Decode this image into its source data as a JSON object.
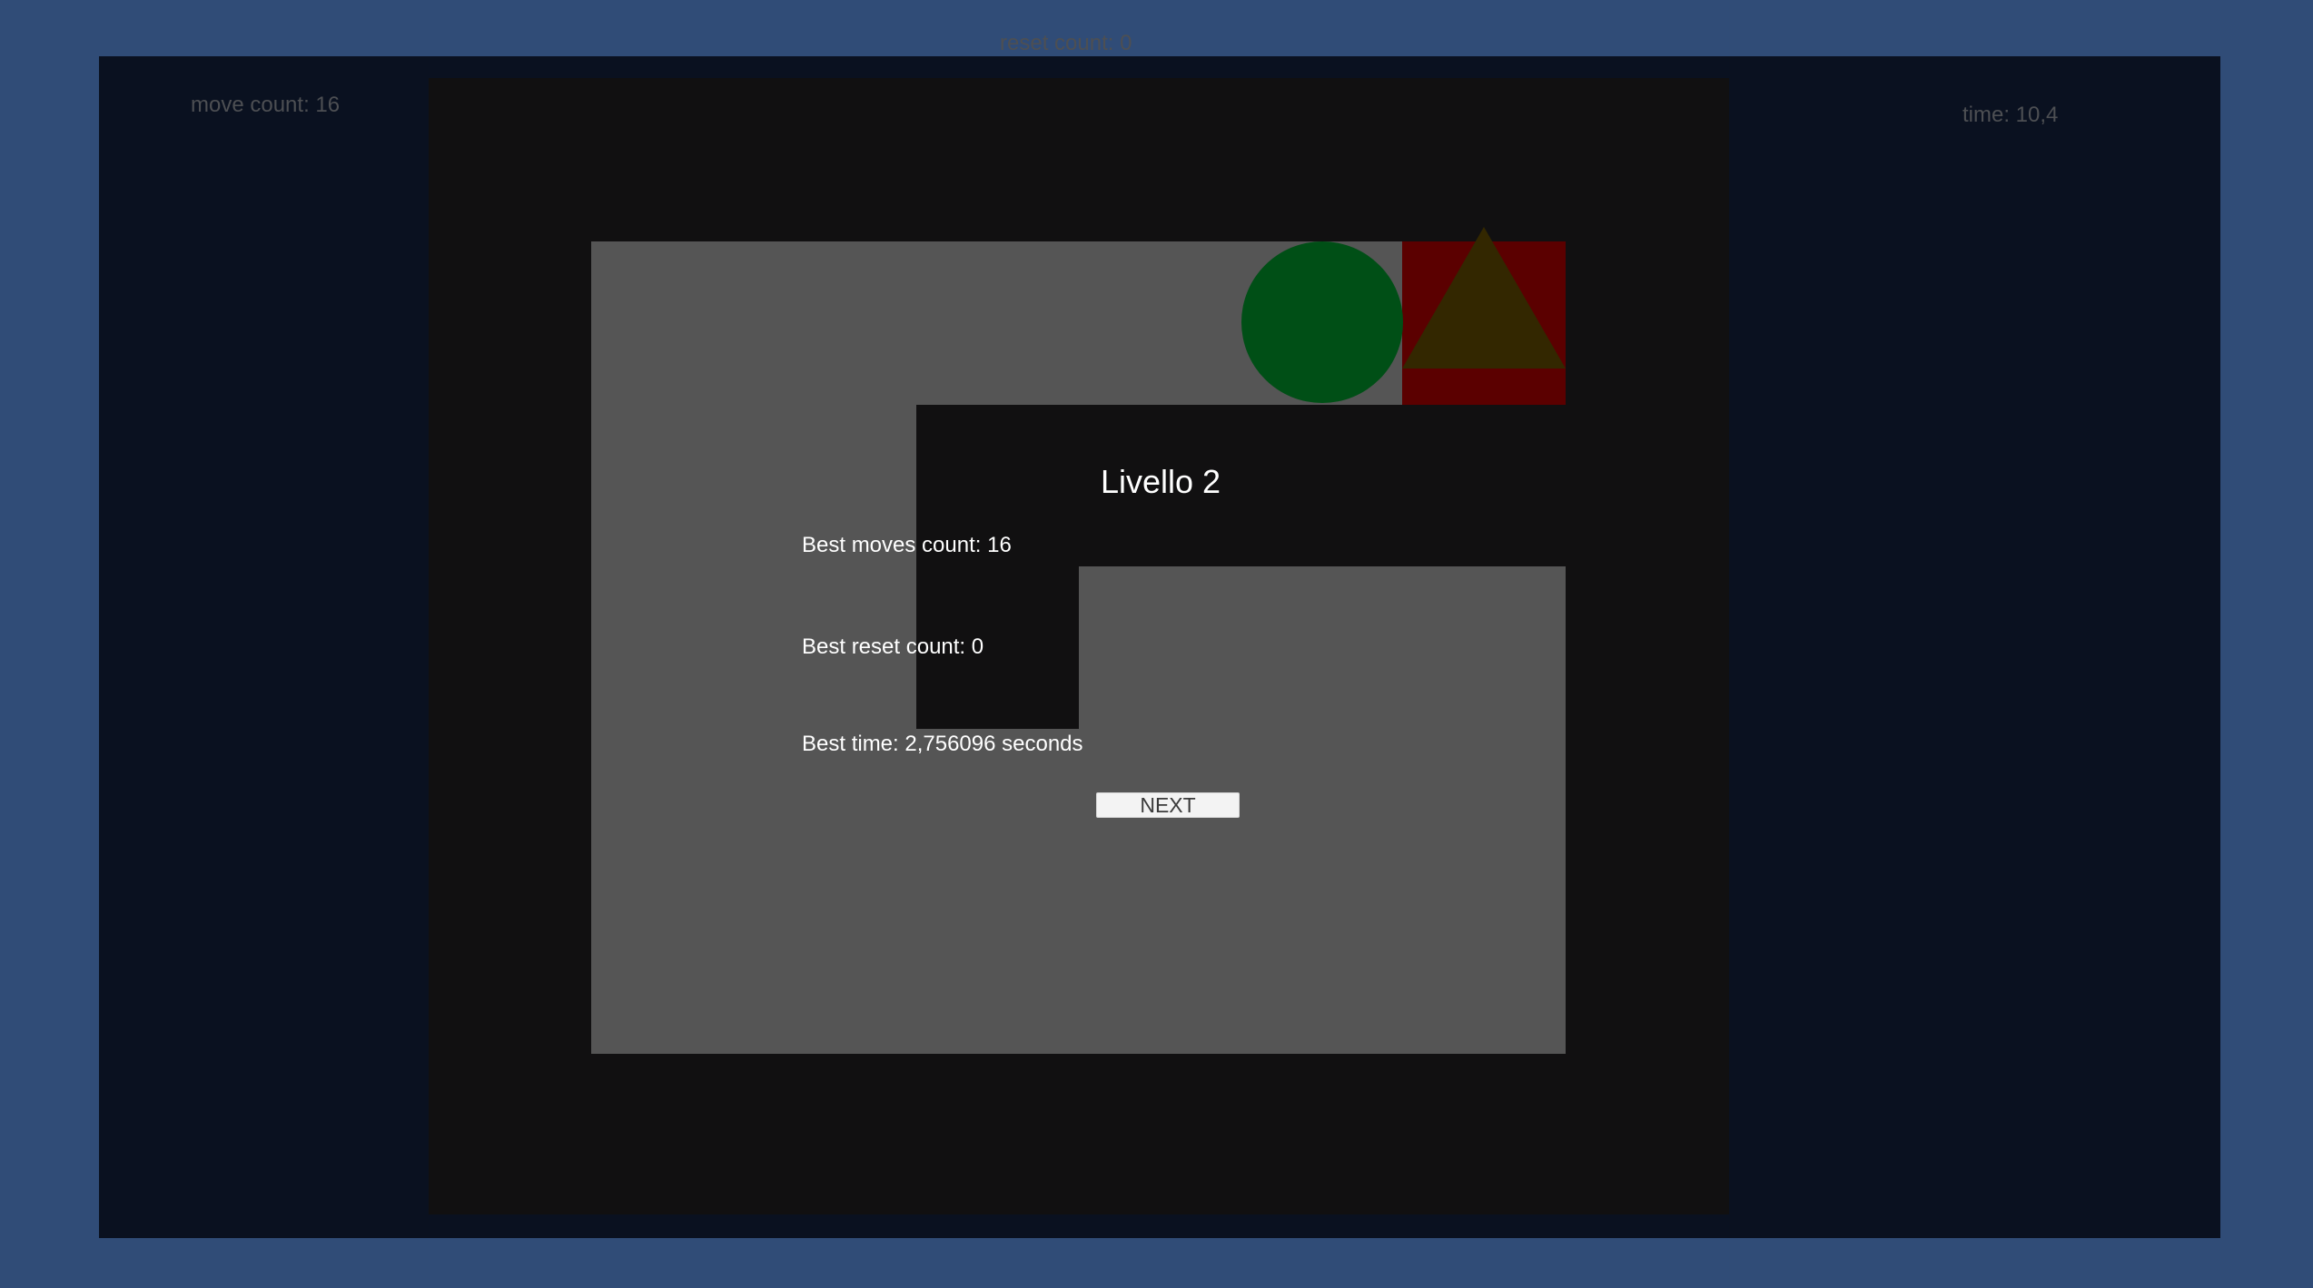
{
  "hud": {
    "move_count": "move count: 16",
    "reset_count": "reset count: 0",
    "time": "time: 10,4"
  },
  "level_complete": {
    "title": "Livello 2",
    "best_moves": "Best moves count: 16",
    "best_reset": "Best reset count: 0",
    "best_time": "Best time: 2,756096 seconds",
    "next_label": "NEXT"
  },
  "icons": {
    "player": "green-circle-icon",
    "goal": "triangle-icon"
  },
  "colors": {
    "background": "#304c77",
    "frame": "#0a1120",
    "board": "#111011",
    "floor": "#555555",
    "player": "#004f16",
    "goal_tile": "#5b0000",
    "goal_triangle": "#332700",
    "text": "#ffffff",
    "hud_text": "#4d4f53"
  }
}
